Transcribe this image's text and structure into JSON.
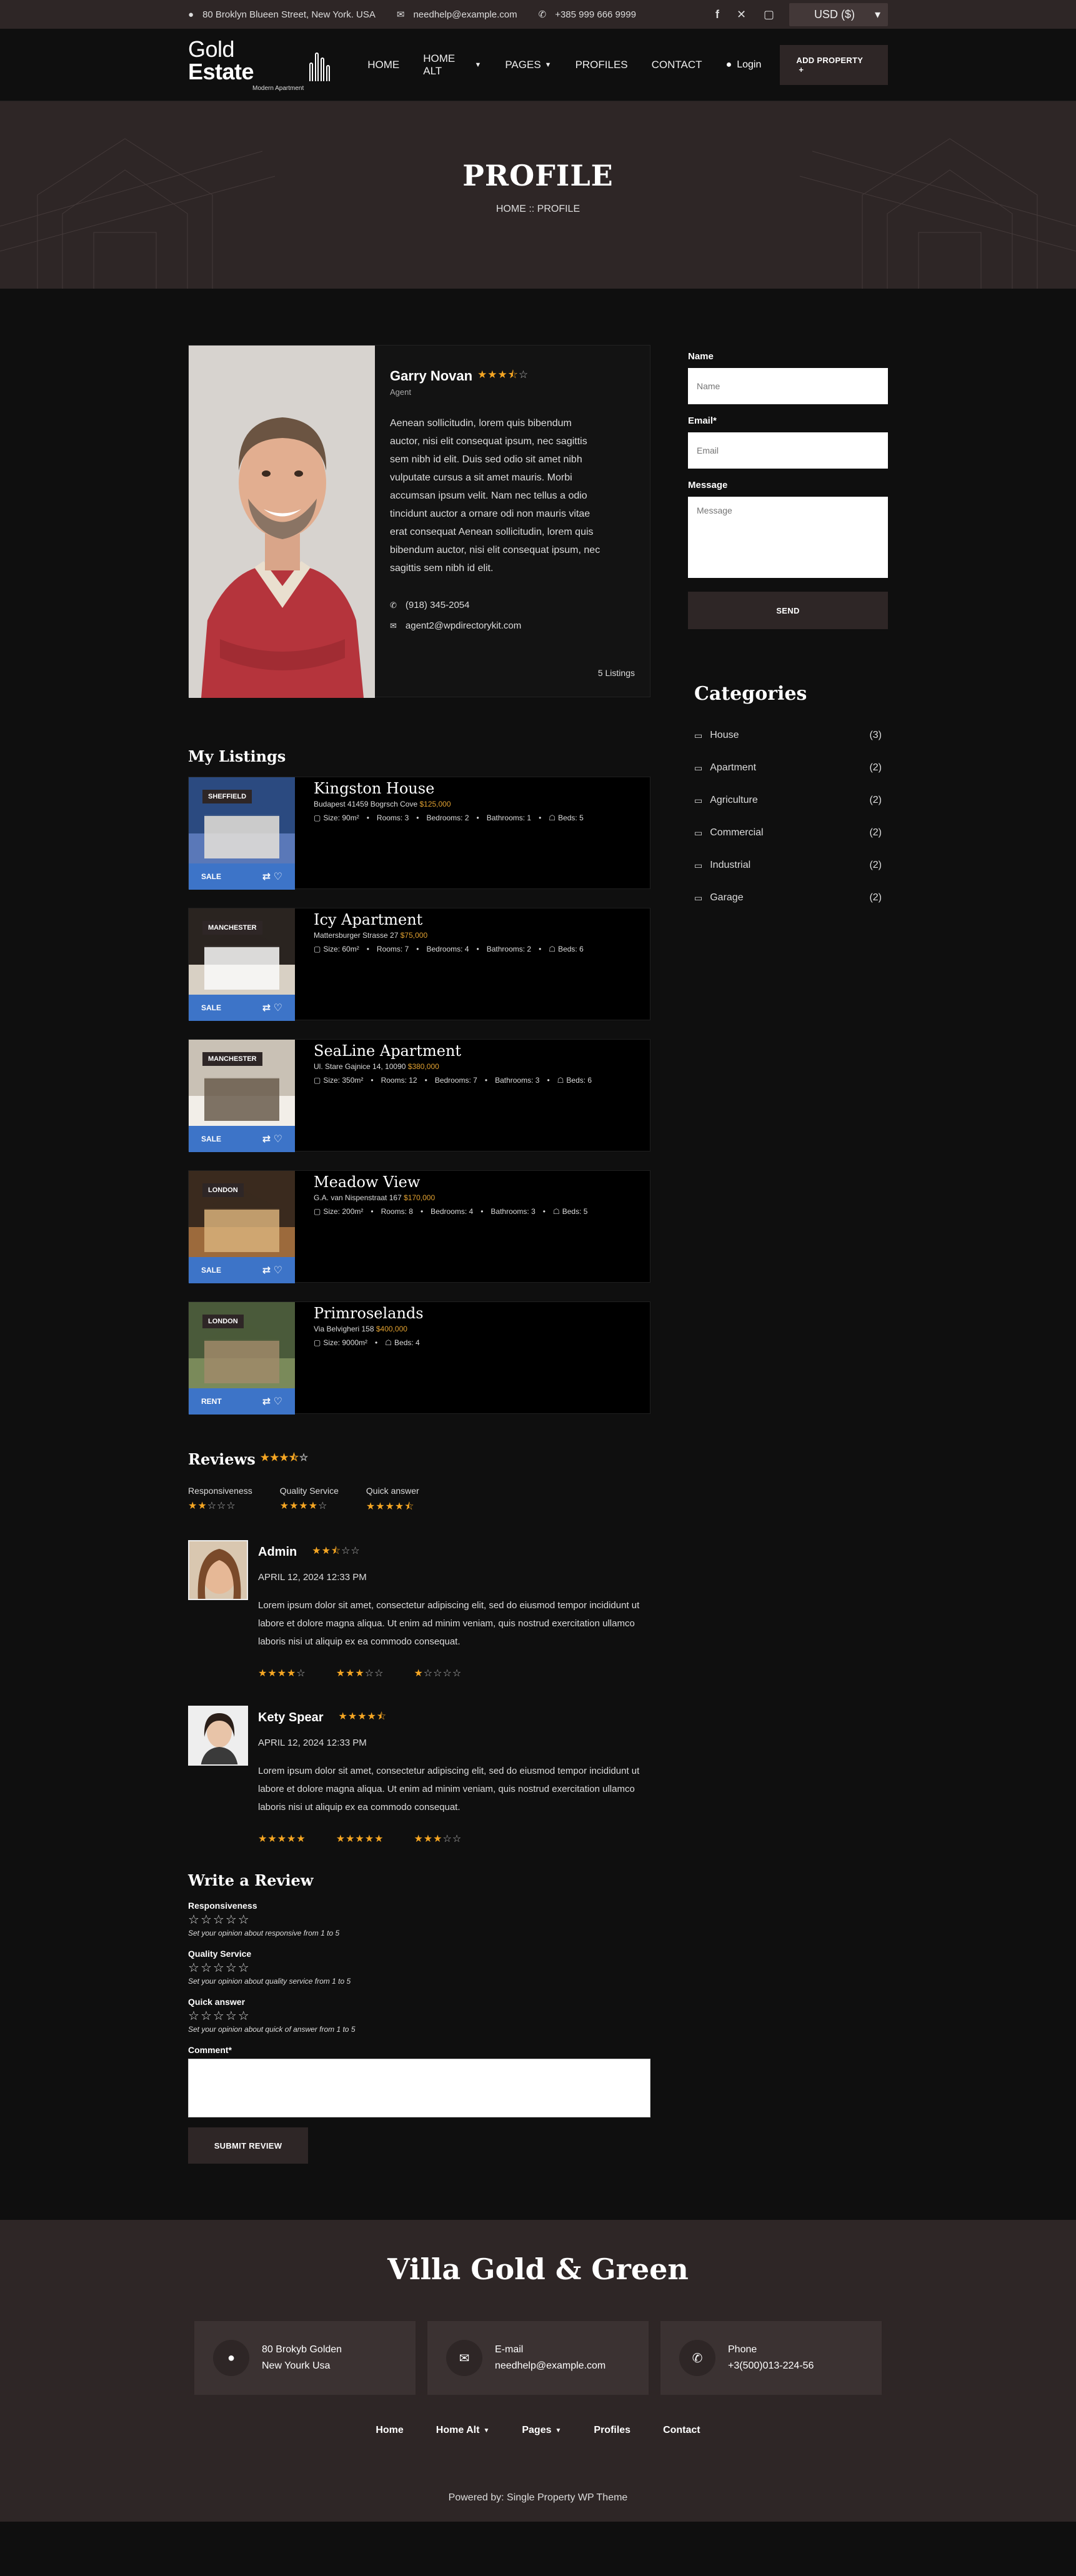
{
  "topbar": {
    "address": "80 Broklyn Blueen Street, New York. USA",
    "email": "needhelp@example.com",
    "phone": "+385 999 666 9999",
    "currency": "USD ($)"
  },
  "header": {
    "logo_main": "Gold",
    "logo_bold": "Estate",
    "logo_sub": "Modern Apartment",
    "nav": [
      {
        "label": "HOME",
        "dropdown": false
      },
      {
        "label": "HOME ALT",
        "dropdown": true
      },
      {
        "label": "PAGES",
        "dropdown": true
      },
      {
        "label": "PROFILES",
        "dropdown": false
      },
      {
        "label": "CONTACT",
        "dropdown": false
      }
    ],
    "login": "Login",
    "add_property": "ADD PROPERTY"
  },
  "banner": {
    "title": "PROFILE",
    "breadcrumb": "HOME :: PROFILE"
  },
  "agent": {
    "name": "Garry Novan",
    "rating": 3.5,
    "role": "Agent",
    "bio": "Aenean sollicitudin, lorem quis bibendum auctor, nisi elit consequat ipsum, nec sagittis sem nibh id elit. Duis sed odio sit amet nibh vulputate cursus a sit amet mauris. Morbi accumsan ipsum velit. Nam nec tellus a odio tincidunt auctor a ornare odi non mauris vitae erat consequat Aenean sollicitudin, lorem quis bibendum auctor, nisi elit consequat ipsum, nec sagittis sem nibh id elit.",
    "phone": "(918) 345-2054",
    "email": "agent2@wpdirectorykit.com",
    "listings_count": "5 Listings"
  },
  "listings": {
    "title": "My Listings",
    "items": [
      {
        "city": "SHEFFIELD",
        "tag": "SALE",
        "title": "Kingston House",
        "address": "Budapest 41459 Bogrsch Cove",
        "price": "$125,000",
        "features": [
          "Size: 90m²",
          "Rooms: 3",
          "Bedrooms: 2",
          "Bathrooms: 1",
          "Beds: 5"
        ]
      },
      {
        "city": "MANCHESTER",
        "tag": "SALE",
        "title": "Icy Apartment",
        "address": "Mattersburger Strasse 27",
        "price": "$75,000",
        "features": [
          "Size: 60m²",
          "Rooms: 7",
          "Bedrooms: 4",
          "Bathrooms: 2",
          "Beds: 6"
        ]
      },
      {
        "city": "MANCHESTER",
        "tag": "SALE",
        "title": "SeaLine Apartment",
        "address": "Ul. Stare Gajnice 14, 10090",
        "price": "$380,000",
        "features": [
          "Size: 350m²",
          "Rooms: 12",
          "Bedrooms: 7",
          "Bathrooms: 3",
          "Beds: 6"
        ]
      },
      {
        "city": "LONDON",
        "tag": "SALE",
        "title": "Meadow View",
        "address": "G.A. van Nispenstraat 167",
        "price": "$170,000",
        "features": [
          "Size: 200m²",
          "Rooms: 8",
          "Bedrooms: 4",
          "Bathrooms: 3",
          "Beds: 5"
        ]
      },
      {
        "city": "LONDON",
        "tag": "RENT",
        "title": "Primroselands",
        "address": "Via Belvigheri 158",
        "price": "$400,000",
        "features": [
          "Size: 9000m²",
          "Beds: 4"
        ]
      }
    ]
  },
  "reviews": {
    "title": "Reviews",
    "overall": 3.5,
    "summary": [
      {
        "label": "Responsiveness",
        "rating": 2
      },
      {
        "label": "Quality Service",
        "rating": 4
      },
      {
        "label": "Quick answer",
        "rating": 4.5
      }
    ],
    "items": [
      {
        "name": "Admin",
        "rating": 2.5,
        "date": "APRIL 12, 2024 12:33 PM",
        "text": "Lorem ipsum dolor sit amet, consectetur adipiscing elit, sed do eiusmod tempor incididunt ut labore et dolore magna aliqua. Ut enim ad minim veniam, quis nostrud exercitation ullamco laboris nisi ut aliquip ex ea commodo consequat.",
        "criteria": [
          4,
          3,
          1
        ]
      },
      {
        "name": "Kety Spear",
        "rating": 4.5,
        "date": "APRIL 12, 2024 12:33 PM",
        "text": "Lorem ipsum dolor sit amet, consectetur adipiscing elit, sed do eiusmod tempor incididunt ut labore et dolore magna aliqua. Ut enim ad minim veniam, quis nostrud exercitation ullamco laboris nisi ut aliquip ex ea commodo consequat.",
        "criteria": [
          5,
          5,
          3
        ]
      }
    ]
  },
  "write_review": {
    "title": "Write a Review",
    "fields": [
      {
        "label": "Responsiveness",
        "hint": "Set your opinion about responsive from 1 to 5"
      },
      {
        "label": "Quality Service",
        "hint": "Set your opinion about quality service from 1 to 5"
      },
      {
        "label": "Quick answer",
        "hint": "Set your opinion about quick of answer from 1 to 5"
      }
    ],
    "comment_label": "Comment*",
    "submit": "SUBMIT REVIEW"
  },
  "contact_form": {
    "name_label": "Name",
    "name_placeholder": "Name",
    "email_label": "Email*",
    "email_placeholder": "Email",
    "message_label": "Message",
    "message_placeholder": "Message",
    "send": "SEND"
  },
  "categories": {
    "title": "Categories",
    "items": [
      {
        "label": "House",
        "count": "(3)"
      },
      {
        "label": "Apartment",
        "count": "(2)"
      },
      {
        "label": "Agriculture",
        "count": "(2)"
      },
      {
        "label": "Commercial",
        "count": "(2)"
      },
      {
        "label": "Industrial",
        "count": "(2)"
      },
      {
        "label": "Garage",
        "count": "(2)"
      }
    ]
  },
  "footer": {
    "title": "Villa Gold & Green",
    "address_l1": "80 Brokyb Golden",
    "address_l2": "New Yourk Usa",
    "email_label": "E-mail",
    "email": "needhelp@example.com",
    "phone_label": "Phone",
    "phone": "+3(500)013-224-56",
    "nav": [
      {
        "label": "Home",
        "dropdown": false
      },
      {
        "label": "Home Alt",
        "dropdown": true
      },
      {
        "label": "Pages",
        "dropdown": true
      },
      {
        "label": "Profiles",
        "dropdown": false
      },
      {
        "label": "Contact",
        "dropdown": false
      }
    ],
    "powered": "Powered by: Single Property WP Theme"
  },
  "colors": {
    "accent": "#2e2626",
    "star": "#f5a623",
    "tag_bar": "#3d74c8",
    "background": "#0f0f0f"
  }
}
